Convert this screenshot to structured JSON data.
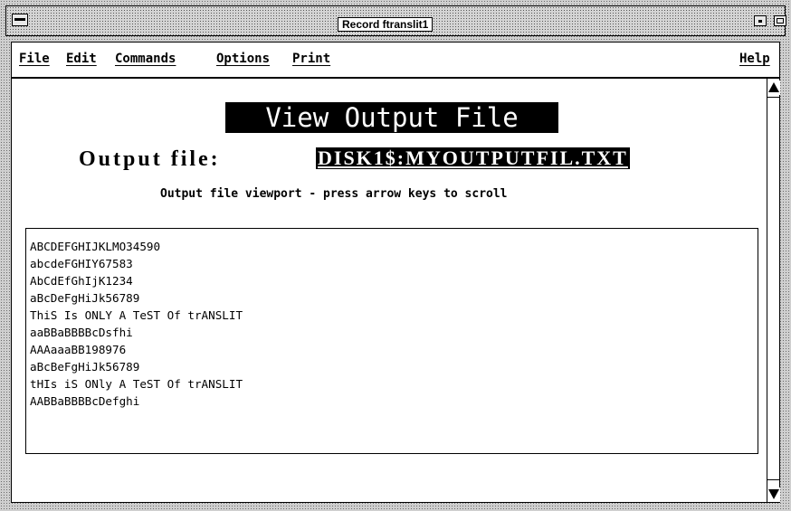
{
  "window": {
    "title": "Record ftranslit1"
  },
  "menubar": {
    "file": "File",
    "edit": "Edit",
    "commands": "Commands",
    "options": "Options",
    "print": "Print",
    "help": "Help"
  },
  "main": {
    "heading": "View Output File",
    "output_label": "Output file:",
    "output_value": "DISK1$:MYOUTPUTFIL.TXT",
    "viewport_hint": "Output file viewport - press arrow keys to scroll",
    "lines": [
      "ABCDEFGHIJKLMO34590",
      "abcdeFGHIY67583",
      "AbCdEfGhIjK1234",
      "aBcDeFgHiJk56789",
      "ThiS Is ONLY A TeST Of trANSLIT",
      "aaBBaBBBBcDsfhi",
      "AAAaaaBB198976",
      "aBcBeFgHiJk56789",
      "tHIs iS ONly A TeST Of trANSLIT",
      "AABBaBBBBcDefghi"
    ]
  },
  "icons": {
    "window_menu": "window-menu-icon",
    "minimize": "minimize-icon",
    "maximize": "maximize-icon",
    "scroll_up": "scroll-up-arrow-icon",
    "scroll_down": "scroll-down-arrow-icon"
  }
}
